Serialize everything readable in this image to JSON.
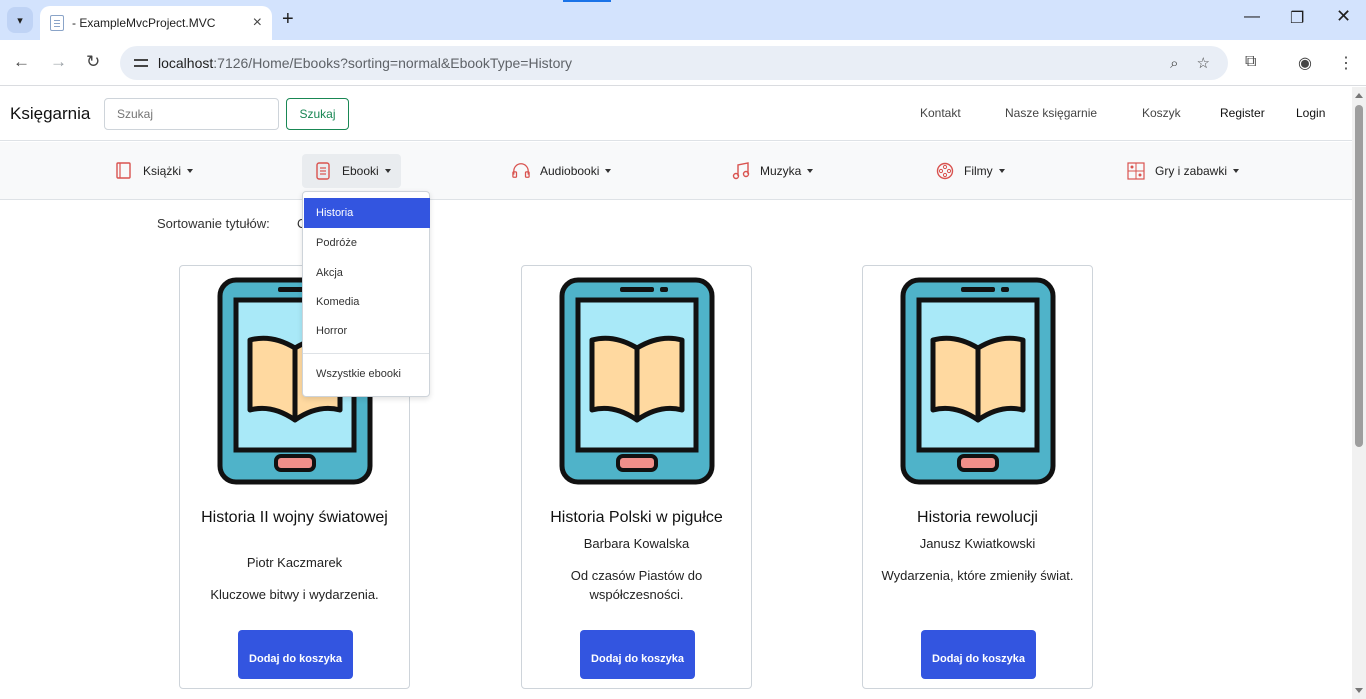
{
  "browser": {
    "tab_title": "- ExampleMvcProject.MVC",
    "url_host": "localhost",
    "url_rest": ":7126/Home/Ebooks?sorting=normal&EbookType=History"
  },
  "header": {
    "brand": "Księgarnia",
    "search_placeholder": "Szukaj",
    "search_button": "Szukaj",
    "links": [
      "Kontakt",
      "Nasze księgarnie",
      "Koszyk",
      "Register",
      "Login"
    ]
  },
  "categories": [
    {
      "label": "Książki",
      "icon": "book-icon"
    },
    {
      "label": "Ebooki",
      "icon": "ebook-icon"
    },
    {
      "label": "Audiobooki",
      "icon": "headphones-icon"
    },
    {
      "label": "Muzyka",
      "icon": "music-note-icon"
    },
    {
      "label": "Filmy",
      "icon": "film-reel-icon"
    },
    {
      "label": "Gry i zabawki",
      "icon": "toys-icon"
    }
  ],
  "sorting": {
    "label": "Sortowanie tytułów:",
    "partial": "O"
  },
  "dropdown": {
    "items": [
      "Historia",
      "Podróże",
      "Akcja",
      "Komedia",
      "Horror"
    ],
    "selected": "Historia",
    "all_label": "Wszystkie ebooki"
  },
  "products": [
    {
      "title": "Historia II wojny światowej",
      "author": "Piotr Kaczmarek",
      "description": "Kluczowe bitwy i wydarzenia.",
      "button": "Dodaj do koszyka"
    },
    {
      "title": "Historia Polski w pigułce",
      "author": "Barbara Kowalska",
      "description": "Od czasów Piastów do współczesności.",
      "button": "Dodaj do koszyka"
    },
    {
      "title": "Historia rewolucji",
      "author": "Janusz Kwiatkowski",
      "description": "Wydarzenia, które zmieniły świat.",
      "button": "Dodaj do koszyka"
    }
  ],
  "colors": {
    "accent": "#3355e0",
    "success": "#198754",
    "icon_red": "#d9534f"
  }
}
